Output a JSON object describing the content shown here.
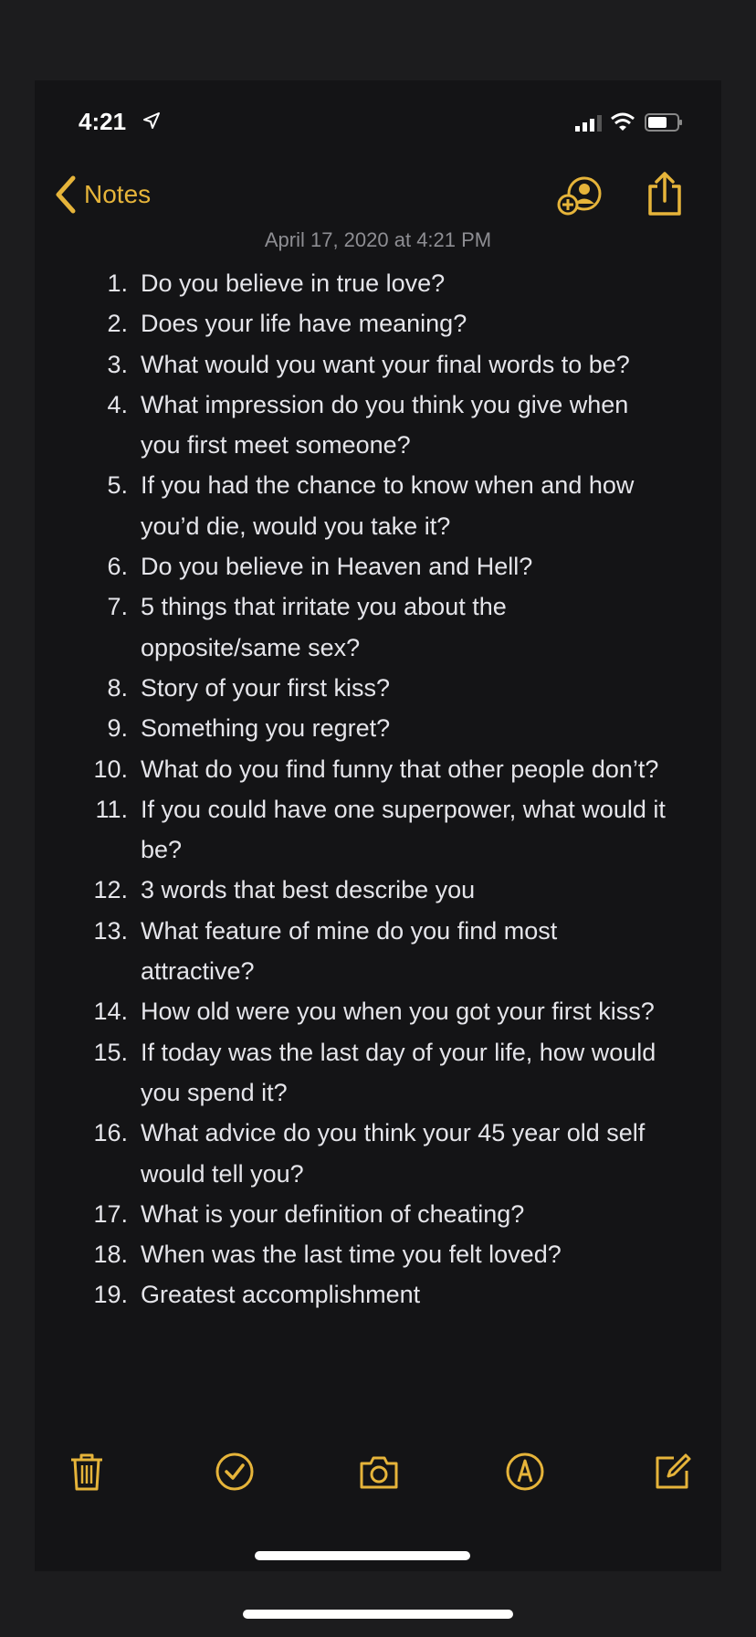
{
  "status_bar": {
    "time": "4:21"
  },
  "nav": {
    "back_label": "Notes"
  },
  "note": {
    "date": "April 17, 2020 at 4:21 PM",
    "items": [
      {
        "num": "1.",
        "text": "Do you believe in true love?"
      },
      {
        "num": "2.",
        "text": "Does your life have meaning?"
      },
      {
        "num": "3.",
        "text": "What would you want your final words to be?"
      },
      {
        "num": "4.",
        "text": "What impression do you think you give when you first meet someone?"
      },
      {
        "num": "5.",
        "text": "If you had the chance to know when and how you’d die, would you take it?"
      },
      {
        "num": "6.",
        "text": "Do you believe in Heaven and Hell?"
      },
      {
        "num": "7.",
        "text": "5 things that irritate you about the opposite/same sex?"
      },
      {
        "num": "8.",
        "text": "Story of your first kiss?"
      },
      {
        "num": "9.",
        "text": "Something you regret?"
      },
      {
        "num": "10.",
        "text": "What do you find funny that other people don’t?"
      },
      {
        "num": "11.",
        "text": "If you could have one superpower, what would it be?"
      },
      {
        "num": "12.",
        "text": "3 words that best describe you"
      },
      {
        "num": "13.",
        "text": "What feature of mine do you find most attractive?"
      },
      {
        "num": "14.",
        "text": "How old were you when you got your first kiss?"
      },
      {
        "num": "15.",
        "text": "If today was the last day of your life, how would you spend it?"
      },
      {
        "num": "16.",
        "text": "What advice do you think your 45 year old self would tell you?"
      },
      {
        "num": "17.",
        "text": "What is your definition of cheating?"
      },
      {
        "num": "18.",
        "text": "When was the last time you felt loved?"
      },
      {
        "num": "19.",
        "text": "Greatest accomplishment"
      }
    ]
  },
  "icons": {
    "back": "chevron-left-icon",
    "collaborate": "add-person-icon",
    "share": "share-icon",
    "trash": "trash-icon",
    "checklist": "checkmark-circle-icon",
    "camera": "camera-icon",
    "markup": "markup-pen-icon",
    "compose": "compose-icon"
  },
  "colors": {
    "accent": "#e6b43a",
    "background": "#141416",
    "text": "#e5e5ea",
    "secondary_text": "#8e8e93"
  }
}
